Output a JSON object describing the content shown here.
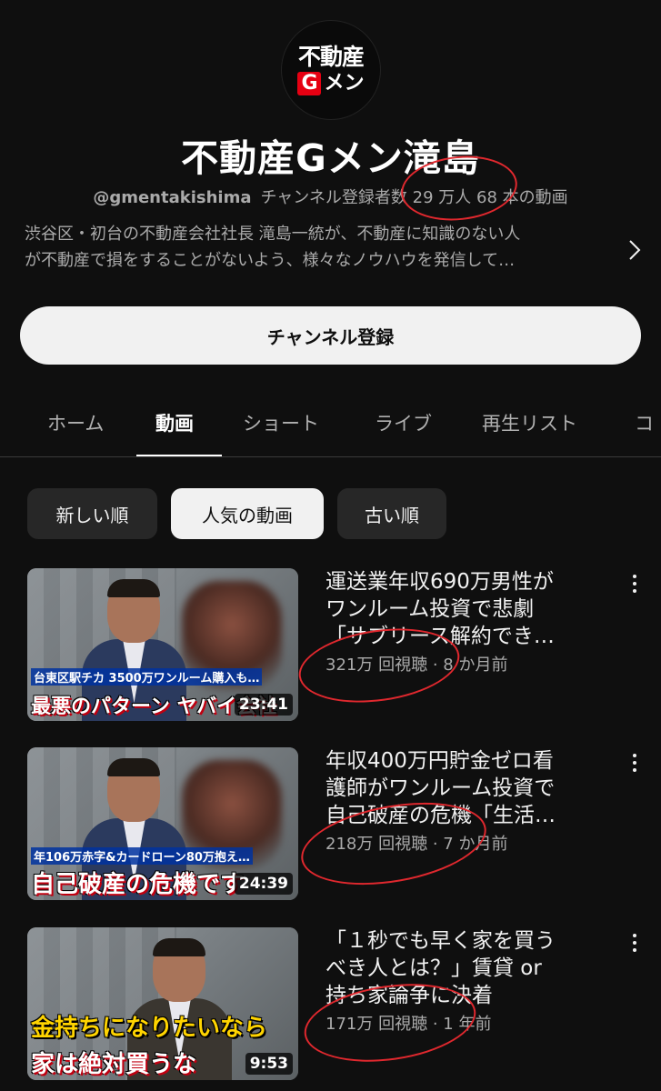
{
  "channel": {
    "logo_line1": "不動産",
    "logo_g": "G",
    "logo_line2": "メン",
    "name": "不動産Gメン滝島",
    "handle": "@gmentakishima",
    "subscribers_label": "チャンネル登録者数",
    "subscribers_count": "29 万人",
    "video_count": "68 本の動画",
    "description_lines": [
      "渋谷区・初台の不動産会社社長 滝島一統が、不動産に知識のない人",
      "が不動産で損をすることがないよう、様々なノウハウを発信して…"
    ],
    "subscribe_label": "チャンネル登録"
  },
  "tabs": [
    "ホーム",
    "動画",
    "ショート",
    "ライブ",
    "再生リスト",
    "コ"
  ],
  "active_tab": "動画",
  "filters": [
    "新しい順",
    "人気の動画",
    "古い順"
  ],
  "selected_filter": "人気の動画",
  "videos": [
    {
      "title_lines": [
        "運送業年収690万男性が",
        "ワンルーム投資で悲劇",
        "「サブリース解約でき…"
      ],
      "views": "321万 回視聴",
      "age": "8 か月前",
      "duration": "23:41",
      "caption_top": "台東区駅チカ 3500万ワンルーム購入も…",
      "caption_bottom": "最悪のパターン ヤバイ会社"
    },
    {
      "title_lines": [
        "年収400万円貯金ゼロ看",
        "護師がワンルーム投資で",
        "自己破産の危機「生活…"
      ],
      "views": "218万 回視聴",
      "age": "7 か月前",
      "duration": "24:39",
      "caption_top": "年106万赤字&カードローン80万抱え…",
      "caption_bottom": "自己破産の危機です"
    },
    {
      "title_lines": [
        "「１秒でも早く家を買う",
        "べき人とは？」賃貸 or",
        "持ち家論争に決着"
      ],
      "views": "171万 回視聴",
      "age": "1 年前",
      "duration": "9:53",
      "caption_top": "金持ちになりたいなら",
      "caption_bottom": "家は絶対買うな"
    }
  ],
  "separator": "·",
  "icons": {
    "chevron": "chevron-right-icon",
    "menu": "more-vert-icon"
  },
  "colors": {
    "background": "#0f0f0f",
    "annotation": "#e0282e",
    "accent_red": "#e60012"
  }
}
